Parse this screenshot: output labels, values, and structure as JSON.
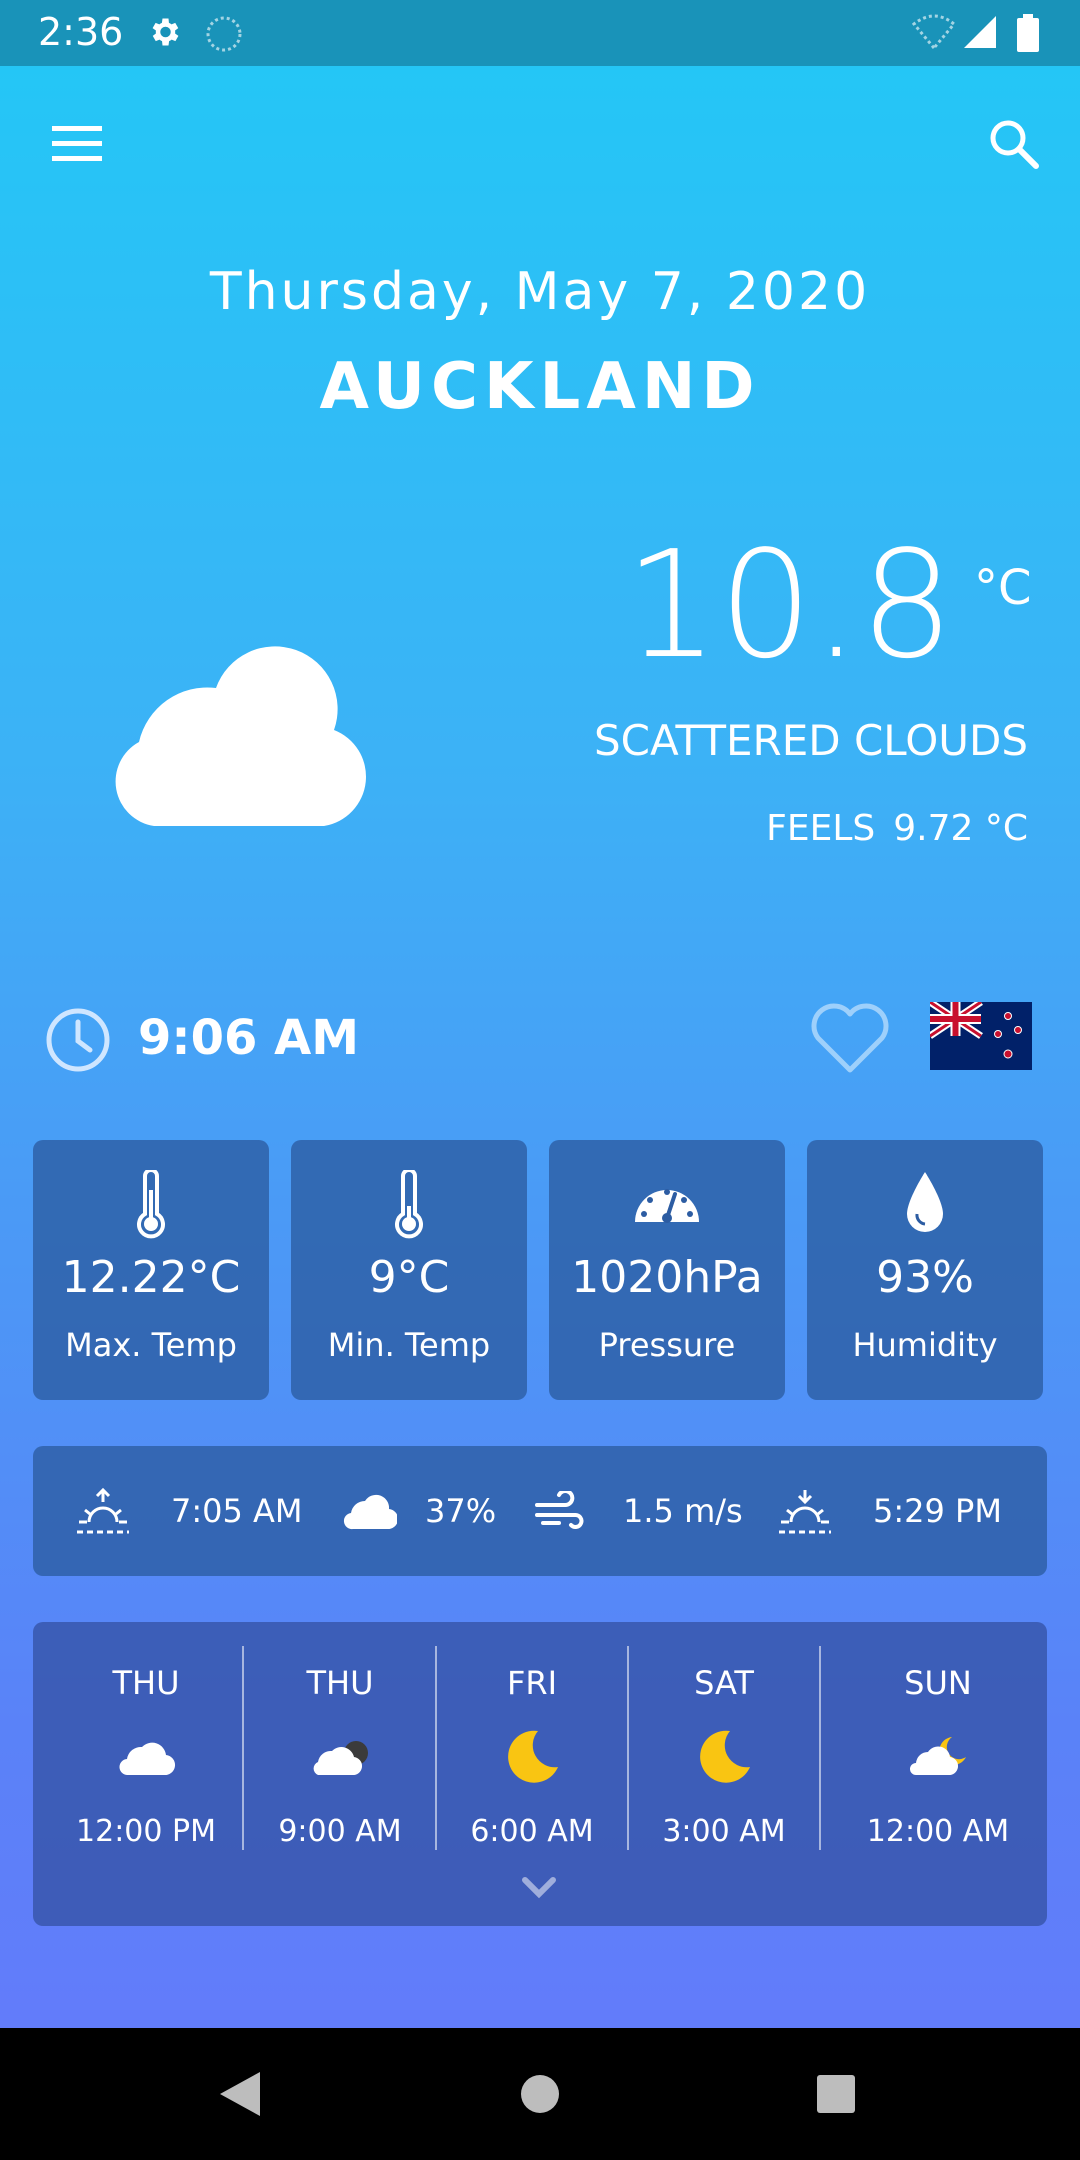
{
  "status_bar": {
    "time": "2:36",
    "icons": [
      "settings-gear-icon",
      "app-notification-icon",
      "wifi-icon",
      "cell-signal-icon",
      "battery-icon"
    ]
  },
  "app_bar": {
    "menu_icon": "menu-icon",
    "search_icon": "search-icon"
  },
  "header": {
    "date": "Thursday, May 7, 2020",
    "city": "AUCKLAND"
  },
  "current": {
    "temperature": "10.8",
    "unit": "°C",
    "description": "SCATTERED CLOUDS",
    "feels_label": "FEELS",
    "feels_value": "9.72 °C",
    "icon": "cloud-icon"
  },
  "local_time": {
    "time": "9:06 AM",
    "favorite": false,
    "country_flag": "new-zealand-flag"
  },
  "stats": [
    {
      "value": "12.22°C",
      "label": "Max. Temp",
      "icon": "thermometer-icon"
    },
    {
      "value": "9°C",
      "label": "Min. Temp",
      "icon": "thermometer-icon"
    },
    {
      "value": "1020hPa",
      "label": "Pressure",
      "icon": "gauge-icon"
    },
    {
      "value": "93%",
      "label": "Humidity",
      "icon": "droplet-icon"
    }
  ],
  "conditions": {
    "sunrise": "7:05 AM",
    "cloudiness": "37%",
    "wind": "1.5 m/s",
    "sunset": "5:29 PM"
  },
  "forecast": [
    {
      "day": "THU",
      "time": "12:00 PM",
      "icon": "cloud-icon"
    },
    {
      "day": "THU",
      "time": "9:00 AM",
      "icon": "cloud-night-icon"
    },
    {
      "day": "FRI",
      "time": "6:00 AM",
      "icon": "moon-icon"
    },
    {
      "day": "SAT",
      "time": "3:00 AM",
      "icon": "moon-icon"
    },
    {
      "day": "SUN",
      "time": "12:00 AM",
      "icon": "moon-cloud-icon"
    }
  ],
  "colors": {
    "status_bar": "#1993b9",
    "card": "#2c5ca2",
    "moon": "#f9c512"
  }
}
